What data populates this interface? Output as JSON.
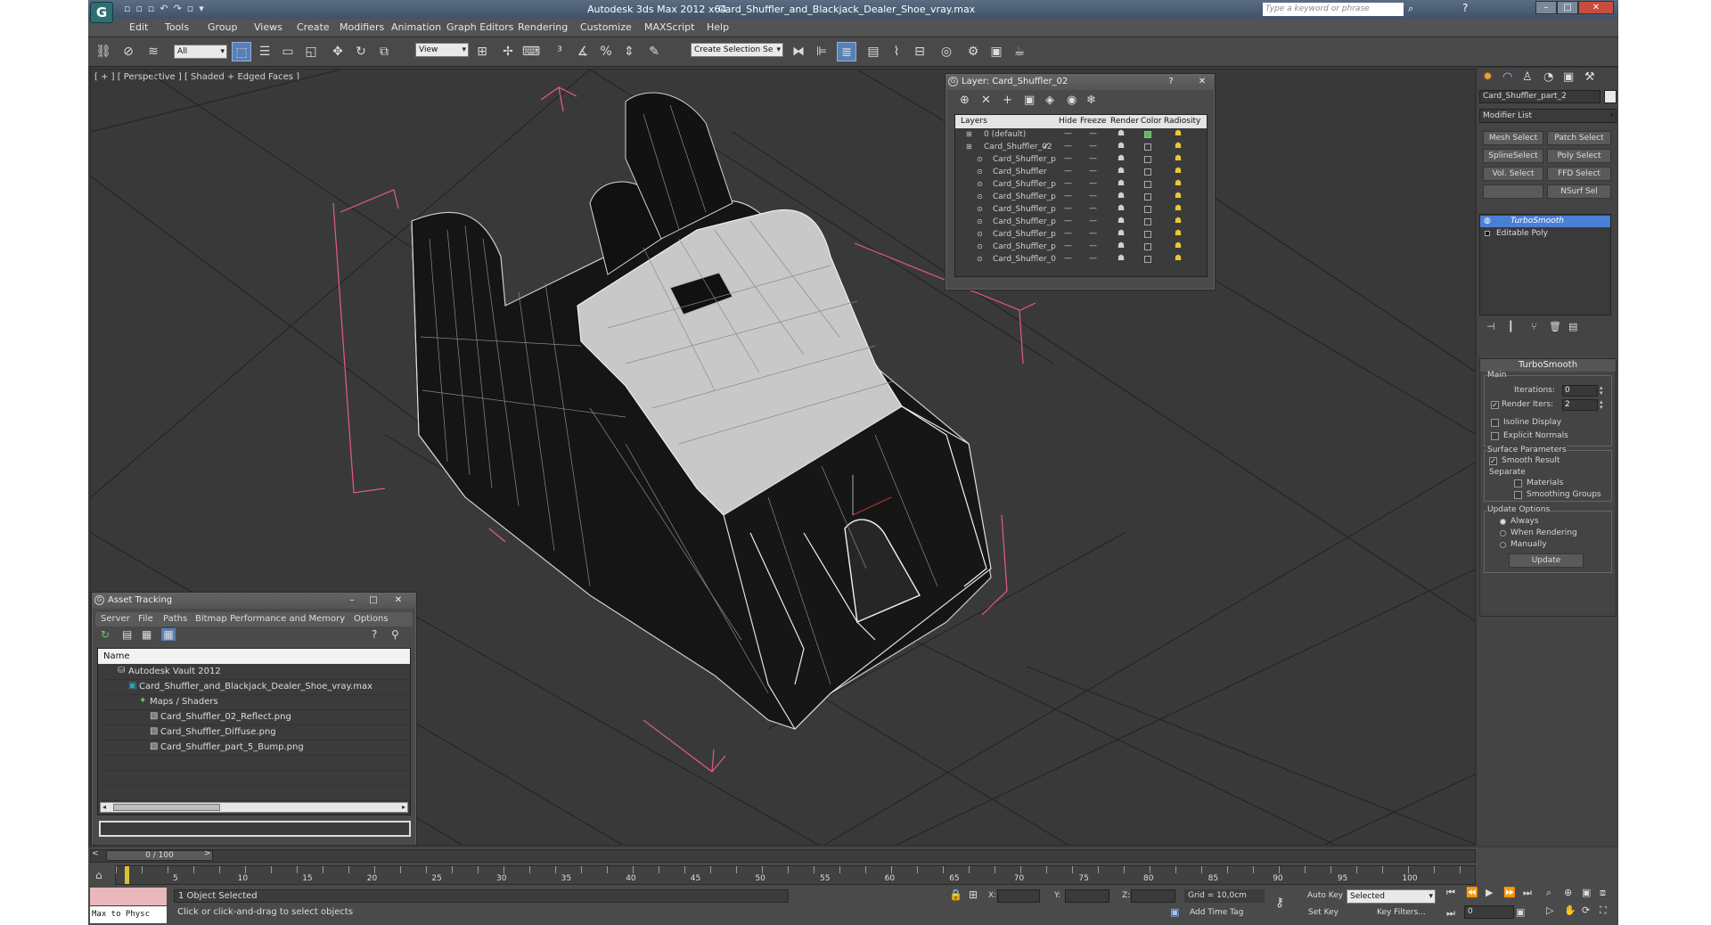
{
  "titlebar": {
    "app": "Autodesk 3ds Max  2012 x64",
    "file": "Card_Shuffler_and_Blackjack_Dealer_Shoe_vray.max",
    "search_placeholder": "Type a keyword or phrase"
  },
  "menu": [
    "Edit",
    "Tools",
    "Group",
    "Views",
    "Create",
    "Modifiers",
    "Animation",
    "Graph Editors",
    "Rendering",
    "Customize",
    "MAXScript",
    "Help"
  ],
  "toolbar": {
    "selection_filter": "All",
    "ref_coord": "View",
    "named_selection": "Create Selection Se"
  },
  "viewport": {
    "label": "[ + ] [ Perspective ] [ Shaded + Edged Faces ]"
  },
  "layer_window": {
    "title": "Layer: Card_Shuffler_02",
    "columns": [
      "Layers",
      "Hide",
      "Freeze",
      "Render",
      "Color",
      "Radiosity"
    ],
    "rows": [
      {
        "name": "0 (default)",
        "indent": 0,
        "color": "#55c24a"
      },
      {
        "name": "Card_Shuffler_02",
        "indent": 0,
        "color": "#3a3a3a"
      },
      {
        "name": "Card_Shuffler_p",
        "indent": 1,
        "color": "#3a3a3a"
      },
      {
        "name": "Card_Shuffler",
        "indent": 1,
        "color": "#3a3a3a"
      },
      {
        "name": "Card_Shuffler_p",
        "indent": 1,
        "color": "#3a3a3a"
      },
      {
        "name": "Card_Shuffler_p",
        "indent": 1,
        "color": "#3a3a3a"
      },
      {
        "name": "Card_Shuffler_p",
        "indent": 1,
        "color": "#3a3a3a"
      },
      {
        "name": "Card_Shuffler_p",
        "indent": 1,
        "color": "#3a3a3a"
      },
      {
        "name": "Card_Shuffler_p",
        "indent": 1,
        "color": "#3a3a3a"
      },
      {
        "name": "Card_Shuffler_p",
        "indent": 1,
        "color": "#3a3a3a"
      },
      {
        "name": "Card_Shuffler_0",
        "indent": 1,
        "color": "#3a3a3a"
      }
    ]
  },
  "asset_tracking": {
    "title": "Asset Tracking",
    "menu": [
      "Server",
      "File",
      "Paths",
      "Bitmap Performance and Memory",
      "Options"
    ],
    "column": "Name",
    "rows": [
      {
        "name": "Autodesk Vault 2012",
        "indent": 0,
        "icon": "vault-icon"
      },
      {
        "name": "Card_Shuffler_and_Blackjack_Dealer_Shoe_vray.max",
        "indent": 1,
        "icon": "max-file-icon"
      },
      {
        "name": "Maps / Shaders",
        "indent": 2,
        "icon": "maps-icon"
      },
      {
        "name": "Card_Shuffler_02_Reflect.png",
        "indent": 3,
        "icon": "image-file-icon"
      },
      {
        "name": "Card_Shuffler_Diffuse.png",
        "indent": 3,
        "icon": "image-file-icon"
      },
      {
        "name": "Card_Shuffler_part_5_Bump.png",
        "indent": 3,
        "icon": "image-file-icon"
      }
    ]
  },
  "command_panel": {
    "object_name": "Card_Shuffler_part_2",
    "modifier_list": "Modifier List",
    "modifier_buttons": [
      "Mesh Select",
      "Patch Select",
      "SplineSelect",
      "Poly Select",
      "Vol. Select",
      "FFD Select",
      "",
      "NSurf Sel"
    ],
    "stack": [
      "TurboSmooth",
      "Editable Poly"
    ],
    "rollout_title": "TurboSmooth",
    "main_label": "Main",
    "iterations_label": "Iterations:",
    "iterations": "0",
    "render_iters_label": "Render Iters:",
    "render_iters": "2",
    "isoline": "Isoline Display",
    "explicit": "Explicit Normals",
    "surface_params": "Surface Parameters",
    "smooth_result": "Smooth Result",
    "separate": "Separate",
    "materials": "Materials",
    "smoothing_groups": "Smoothing Groups",
    "update_options": "Update Options",
    "always": "Always",
    "when_rendering": "When Rendering",
    "manually": "Manually",
    "update": "Update"
  },
  "timeline": {
    "frame": "0 / 100",
    "ticks": [
      "5",
      "10",
      "15",
      "20",
      "25",
      "30",
      "35",
      "40",
      "45",
      "50",
      "55",
      "60",
      "65",
      "70",
      "75",
      "80",
      "85",
      "90",
      "95",
      "100"
    ]
  },
  "status": {
    "script_text": "Max to Physc",
    "selected": "1 Object Selected",
    "prompt": "Click or click-and-drag to select objects",
    "x": "X:",
    "y": "Y:",
    "z": "Z:",
    "grid": "Grid = 10,0cm",
    "add_time_tag": "Add Time Tag",
    "auto_key": "Auto Key",
    "set_key": "Set Key",
    "key_set": "Selected",
    "key_filters": "Key Filters...",
    "frame_field": "0"
  },
  "colors": {
    "ui_bg": "#3c3c3c",
    "selection_blue": "#4a7fd6",
    "wire_pink": "#e45a8c"
  }
}
